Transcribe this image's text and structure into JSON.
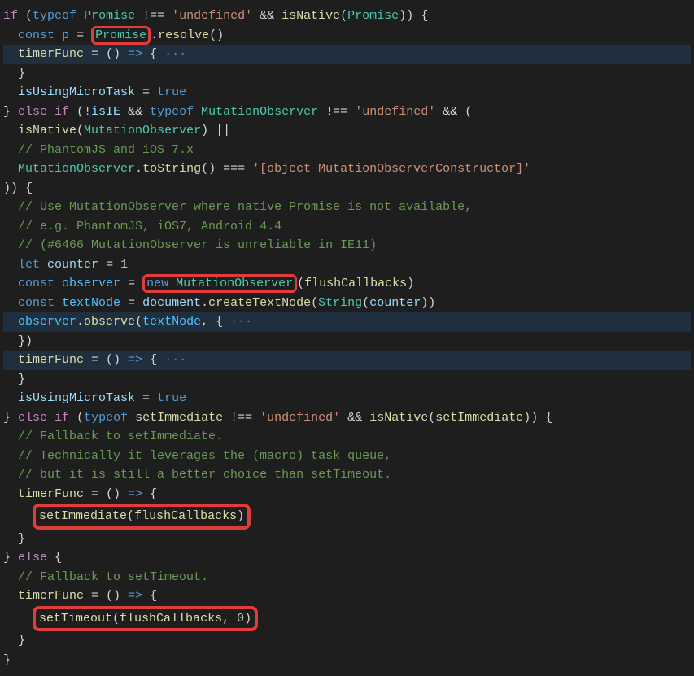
{
  "code": {
    "l01_if": "if",
    "l01_op": " (",
    "l01_typeof": "typeof",
    "l01_sp": " ",
    "l01_prom": "Promise",
    "l01_neq": " !== ",
    "l01_undef": "'undefined'",
    "l01_and": " && ",
    "l01_isnat": "isNative",
    "l01_op2": "(",
    "l01_prom2": "Promise",
    "l01_cp": ")) {",
    "l02_ind": "  ",
    "l02_const": "const",
    "l02_sp": " ",
    "l02_p": "p",
    "l02_eq": " = ",
    "l02_prom": "Promise",
    "l02_dot": ".",
    "l02_resolve": "resolve",
    "l02_call": "()",
    "l03_ind": "  ",
    "l03_tf": "timerFunc",
    "l03_eq": " = () ",
    "l03_arrow": "=>",
    "l03_ob": " {",
    "l03_ell": " ···",
    "l04_ind": "  ",
    "l04_cb": "}",
    "l05_ind": "  ",
    "l05_var": "isUsingMicroTask",
    "l05_eq": " = ",
    "l05_true": "true",
    "l06_cb": "} ",
    "l06_else": "else",
    "l06_sp": " ",
    "l06_if": "if",
    "l06_op": " (!",
    "l06_isie": "isIE",
    "l06_and": " && ",
    "l06_typeof": "typeof",
    "l06_sp2": " ",
    "l06_mo": "MutationObserver",
    "l06_neq": " !== ",
    "l06_undef": "'undefined'",
    "l06_and2": " && (",
    "l07_ind": "  ",
    "l07_isnat": "isNative",
    "l07_op": "(",
    "l07_mo": "MutationObserver",
    "l07_cp": ") ||",
    "l08_ind": "  ",
    "l08_cmt": "// PhantomJS and iOS 7.x",
    "l09_ind": "  ",
    "l09_mo": "MutationObserver",
    "l09_dot": ".",
    "l09_ts": "toString",
    "l09_call": "() === ",
    "l09_str": "'[object MutationObserverConstructor]'",
    "l10_cp": ")) {",
    "l11_ind": "  ",
    "l11_cmt": "// Use MutationObserver where native Promise is not available,",
    "l12_ind": "  ",
    "l12_cmt": "// e.g. PhantomJS, iOS7, Android 4.4",
    "l13_ind": "  ",
    "l13_cmt": "// (#6466 MutationObserver is unreliable in IE11)",
    "l14_ind": "  ",
    "l14_let": "let",
    "l14_sp": " ",
    "l14_var": "counter",
    "l14_eq": " = ",
    "l14_num": "1",
    "l15_ind": "  ",
    "l15_const": "const",
    "l15_sp": " ",
    "l15_var": "observer",
    "l15_eq": " = ",
    "l15_new": "new",
    "l15_sp2": " ",
    "l15_mo": "MutationObserver",
    "l15_op": "(",
    "l15_fc": "flushCallbacks",
    "l15_cp": ")",
    "l16_ind": "  ",
    "l16_const": "const",
    "l16_sp": " ",
    "l16_var": "textNode",
    "l16_eq": " = ",
    "l16_doc": "document",
    "l16_dot": ".",
    "l16_ctn": "createTextNode",
    "l16_op": "(",
    "l16_str": "String",
    "l16_op2": "(",
    "l16_cnt": "counter",
    "l16_cp": "))",
    "l17_ind": "  ",
    "l17_obs": "observer",
    "l17_dot": ".",
    "l17_observe": "observe",
    "l17_op": "(",
    "l17_tn": "textNode",
    "l17_comma": ", {",
    "l17_ell": " ···",
    "l18_ind": "  ",
    "l18_cb": "})",
    "l19_ind": "  ",
    "l19_tf": "timerFunc",
    "l19_eq": " = () ",
    "l19_arrow": "=>",
    "l19_ob": " {",
    "l19_ell": " ···",
    "l20_ind": "  ",
    "l20_cb": "}",
    "l21_ind": "  ",
    "l21_var": "isUsingMicroTask",
    "l21_eq": " = ",
    "l21_true": "true",
    "l22_cb": "} ",
    "l22_else": "else",
    "l22_sp": " ",
    "l22_if": "if",
    "l22_op": " (",
    "l22_typeof": "typeof",
    "l22_sp2": " ",
    "l22_si": "setImmediate",
    "l22_neq": " !== ",
    "l22_undef": "'undefined'",
    "l22_and": " && ",
    "l22_isnat": "isNative",
    "l22_op2": "(",
    "l22_si2": "setImmediate",
    "l22_cp": ")) {",
    "l23_ind": "  ",
    "l23_cmt": "// Fallback to setImmediate.",
    "l24_ind": "  ",
    "l24_cmt": "// Technically it leverages the (macro) task queue,",
    "l25_ind": "  ",
    "l25_cmt": "// but it is still a better choice than setTimeout.",
    "l26_ind": "  ",
    "l26_tf": "timerFunc",
    "l26_eq": " = () ",
    "l26_arrow": "=>",
    "l26_ob": " {",
    "l27_ind": "    ",
    "l27_si": "setImmediate",
    "l27_op": "(",
    "l27_fc": "flushCallbacks",
    "l27_cp": ")",
    "l28_ind": "  ",
    "l28_cb": "}",
    "l29_cb": "} ",
    "l29_else": "else",
    "l29_ob": " {",
    "l30_ind": "  ",
    "l30_cmt": "// Fallback to setTimeout.",
    "l31_ind": "  ",
    "l31_tf": "timerFunc",
    "l31_eq": " = () ",
    "l31_arrow": "=>",
    "l31_ob": " {",
    "l32_ind": "    ",
    "l32_st": "setTimeout",
    "l32_op": "(",
    "l32_fc": "flushCallbacks",
    "l32_comma": ", ",
    "l32_zero": "0",
    "l32_cp": ")",
    "l33_ind": "  ",
    "l33_cb": "}",
    "l34_cb": "}"
  }
}
